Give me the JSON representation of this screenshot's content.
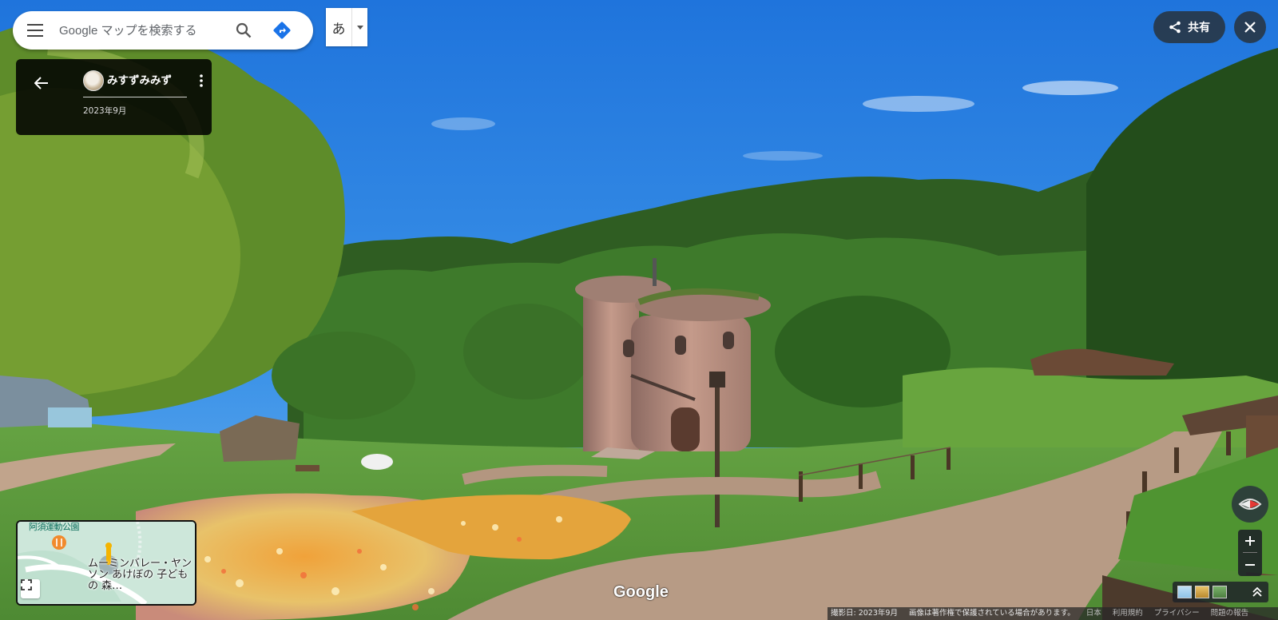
{
  "search": {
    "placeholder": "Google マップを検索する"
  },
  "ime": {
    "char": "あ"
  },
  "info_card": {
    "username": "みすずみみず",
    "date": "2023年9月"
  },
  "share": {
    "label": "共有"
  },
  "minimap": {
    "park_label": "阿須運動公園",
    "place_label": "ムーミンバレー・ヤンソン あけぼの 子どもの 森…"
  },
  "logo": {
    "text": "Google"
  },
  "footer": {
    "capture_date": "撮影日: 2023年9月",
    "copyright": "画像は著作権で保護されている場合があります。",
    "country": "日本",
    "terms": "利用規約",
    "privacy": "プライバシー",
    "report": "問題の報告"
  },
  "icons": {
    "menu": "menu-icon",
    "search": "search-icon",
    "directions": "directions-icon",
    "share": "share-icon",
    "close": "close-icon",
    "back": "arrow-back-icon",
    "more": "more-vert-icon",
    "expand": "fullscreen-icon",
    "compass": "compass-icon",
    "zoom_in": "plus-icon",
    "zoom_out": "minus-icon",
    "layers_expand": "chevron-up-icon"
  },
  "colors": {
    "sky": "#2f86e0",
    "foliage": "#3f6b2c",
    "path": "#b89c86",
    "accent_blue": "#1a73e8"
  }
}
